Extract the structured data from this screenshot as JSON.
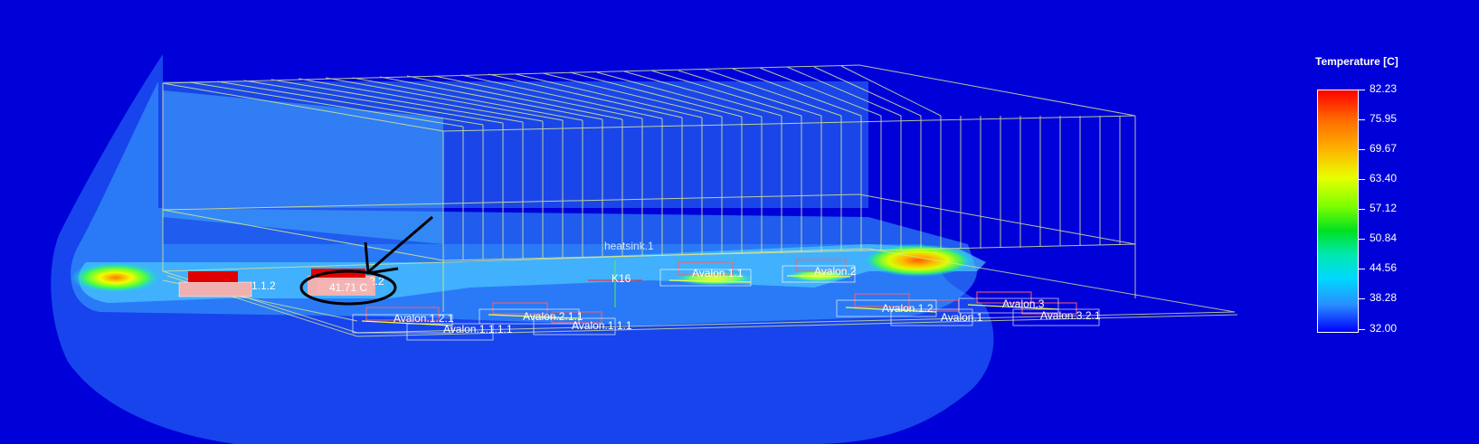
{
  "legend": {
    "title": "Temperature [C]",
    "ticks": [
      "82.23",
      "75.95",
      "69.67",
      "63.40",
      "57.12",
      "50.84",
      "44.56",
      "38.28",
      "32.00"
    ]
  },
  "labels": {
    "heatsink": "heatsink.1",
    "k16": "K16",
    "probe_value": "41.71 C",
    "comp_112": "1.1.2",
    "comp_2": "2.2",
    "avalon_11": "Avalon.1.1",
    "avalon_2": "Avalon.2",
    "avalon_121": "Avalon.1.2.1",
    "avalon_211": "Avalon.2.1.1",
    "avalon_111": "Avalon.1.1.1",
    "avalon_3": "Avalon.3",
    "avalon_12": "Avalon.1.2",
    "avalon_1a": "Avalon.1",
    "avalon_tail": "1.1",
    "avalon_321": "Avalon.3.2.1",
    "avalon_1111": "Avalon.1.1.1.1"
  },
  "colors": {
    "background": "#0000d8",
    "hot": "#ff0000",
    "wire": "#d8e890",
    "annotation": "#000000"
  }
}
